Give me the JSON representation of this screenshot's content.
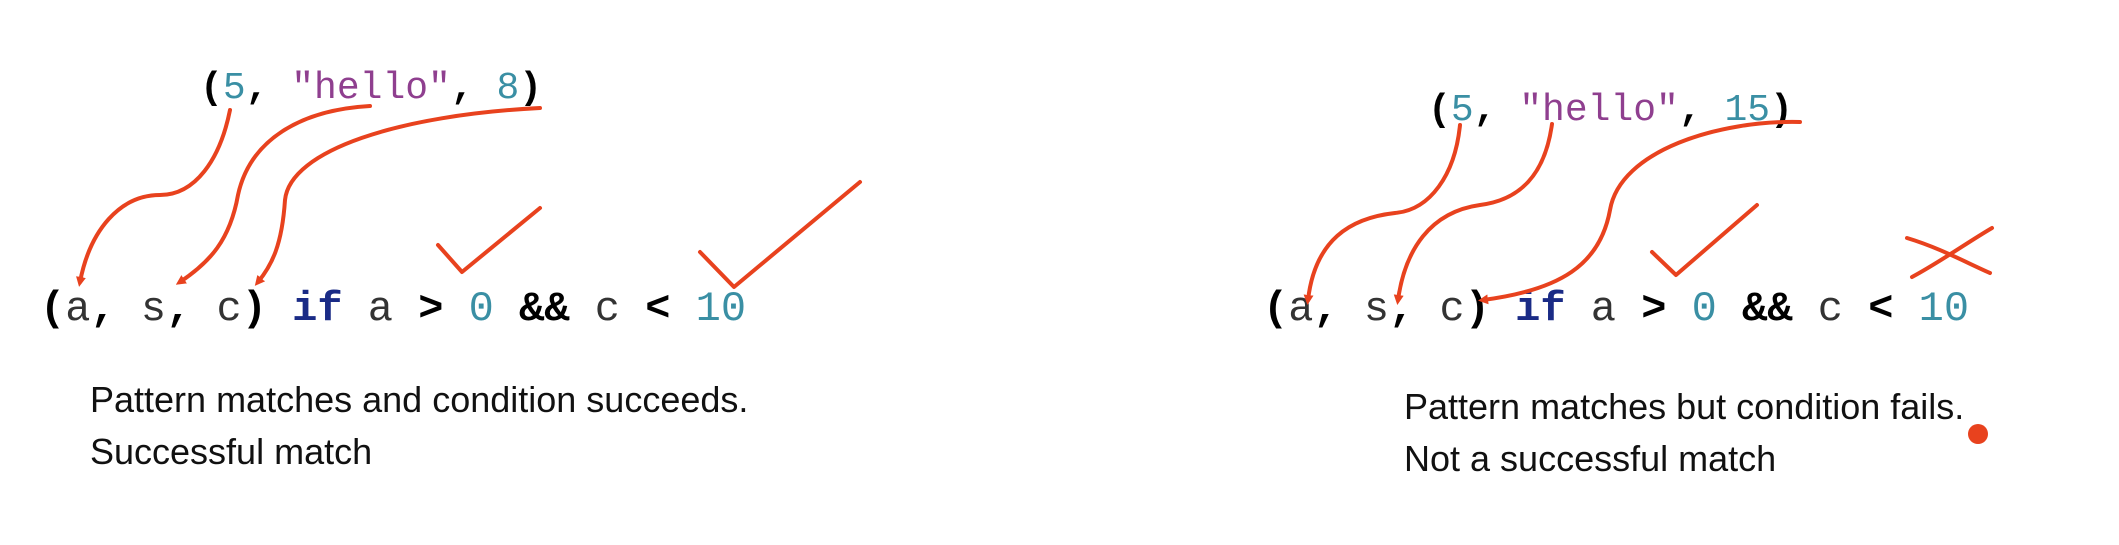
{
  "ink_color": "#e8421e",
  "left": {
    "tuple": {
      "open": "(",
      "a": "5",
      "sep1": ", ",
      "b": "\"hello\"",
      "sep2": ", ",
      "c": "8",
      "close": ")"
    },
    "pattern": {
      "open": "(",
      "v1": "a",
      "sep1": ", ",
      "v2": "s",
      "sep2": ", ",
      "v3": "c",
      "close": ")",
      "kw": "if",
      "lhs": "a",
      "op1": ">",
      "n1": "0",
      "and": "&&",
      "rhs": "c",
      "op2": "<",
      "n2": "10"
    },
    "caption": {
      "line1": "Pattern matches and condition succeeds.",
      "line2": "Successful match"
    },
    "marks": {
      "first_condition": "check",
      "second_condition": "check"
    }
  },
  "right": {
    "tuple": {
      "open": "(",
      "a": "5",
      "sep1": ", ",
      "b": "\"hello\"",
      "sep2": ", ",
      "c": "15",
      "close": ")"
    },
    "pattern": {
      "open": "(",
      "v1": "a",
      "sep1": ", ",
      "v2": "s",
      "sep2": ", ",
      "v3": "c",
      "close": ")",
      "kw": "if",
      "lhs": "a",
      "op1": ">",
      "n1": "0",
      "and": "&&",
      "rhs": "c",
      "op2": "<",
      "n2": "10"
    },
    "caption": {
      "line1": "Pattern matches but condition fails.",
      "line2": "Not a successful match"
    },
    "marks": {
      "first_condition": "check",
      "second_condition": "cross"
    }
  }
}
